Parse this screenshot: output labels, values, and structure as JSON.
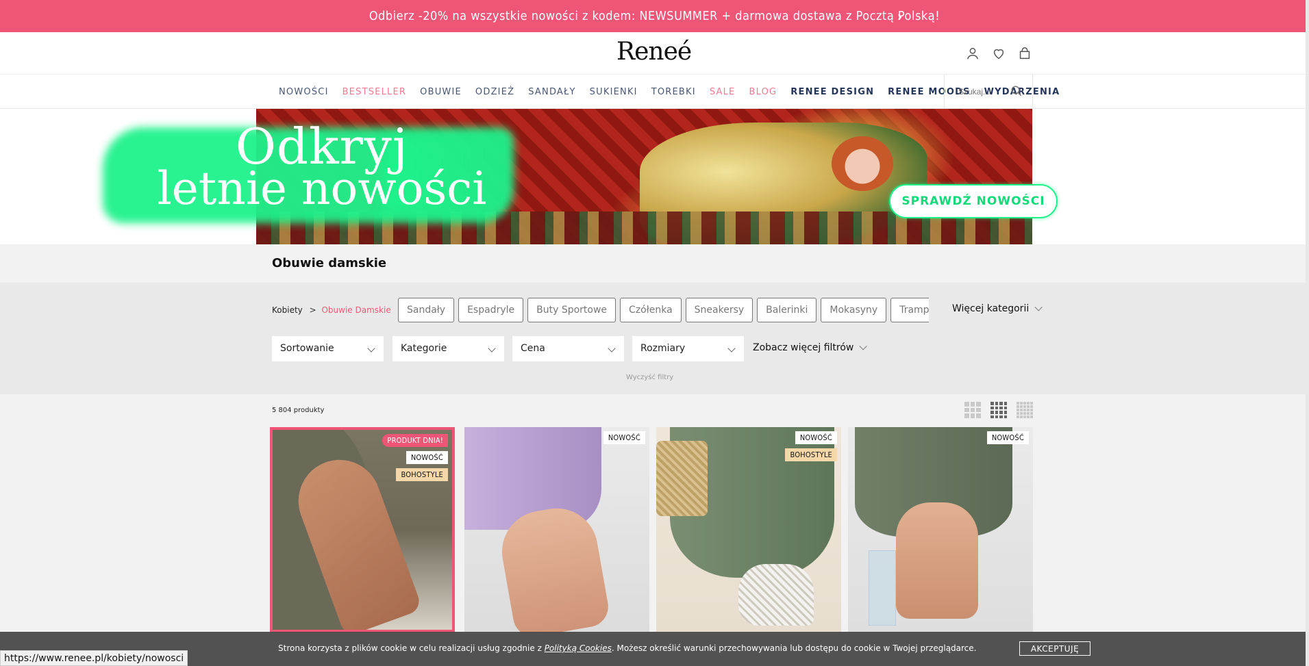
{
  "promo": {
    "text": "Odbierz -20% na wszystkie nowości z kodem: NEWSUMMER + darmowa dostawa z Pocztą Polską!",
    "chevron": "›"
  },
  "header": {
    "logo": "Reneé",
    "icons": [
      "user-icon",
      "heart-icon",
      "bag-icon"
    ]
  },
  "nav": {
    "items": [
      {
        "label": "NOWOŚCI",
        "style": "normal"
      },
      {
        "label": "BESTSELLER",
        "style": "pink"
      },
      {
        "label": "OBUWIE",
        "style": "normal"
      },
      {
        "label": "ODZIEŻ",
        "style": "normal"
      },
      {
        "label": "SANDAŁY",
        "style": "normal"
      },
      {
        "label": "SUKIENKI",
        "style": "normal"
      },
      {
        "label": "TOREBKI",
        "style": "normal"
      },
      {
        "label": "SALE",
        "style": "pink"
      },
      {
        "label": "BLOG",
        "style": "pink"
      },
      {
        "label": "RENEE DESIGN",
        "style": "bold"
      },
      {
        "label": "RENEE MOODS",
        "style": "bold"
      },
      {
        "label": "WYDARZENIA",
        "style": "bold"
      }
    ],
    "search_placeholder": "Szukaj..."
  },
  "banner": {
    "headline_line1": "Odkryj",
    "headline_line2": "letnie nowości",
    "cta": "SPRAWDŹ NOWOŚCI"
  },
  "page": {
    "title": "Obuwie damskie"
  },
  "breadcrumb": {
    "parent": "Kobiety",
    "separator": ">",
    "current": "Obuwie Damskie"
  },
  "categories": [
    "Sandały",
    "Espadryle",
    "Buty Sportowe",
    "Czółenka",
    "Sneakersy",
    "Balerinki",
    "Mokasyny",
    "Trampki"
  ],
  "more_categories": "Więcej kategorii",
  "filters": {
    "sort": "Sortowanie",
    "category": "Kategorie",
    "price": "Cena",
    "sizes": "Rozmiary",
    "more": "Zobacz więcej filtrów",
    "clear": "Wyczyść filtry"
  },
  "products": {
    "count": "5 804 produkty",
    "items": [
      {
        "badges": [
          {
            "text": "PRODUKT DNIA!",
            "type": "pink"
          },
          {
            "text": "NOWOŚĆ",
            "type": "white"
          },
          {
            "text": "BOHOSTYLE",
            "type": "boho"
          }
        ],
        "highlighted": true
      },
      {
        "badges": [
          {
            "text": "NOWOŚĆ",
            "type": "white"
          }
        ],
        "highlighted": false
      },
      {
        "badges": [
          {
            "text": "NOWOŚĆ",
            "type": "white"
          },
          {
            "text": "BOHOSTYLE",
            "type": "boho"
          }
        ],
        "highlighted": false
      },
      {
        "badges": [
          {
            "text": "NOWOŚĆ",
            "type": "white"
          }
        ],
        "highlighted": false
      }
    ]
  },
  "cookie": {
    "text_before": "Strona korzysta z plików cookie w celu realizacji usług zgodnie z ",
    "link": "Polityką Cookies",
    "text_after": ". Możesz określić warunki przechowywania lub dostępu do cookie w Twojej przeglądarce.",
    "accept": "AKCEPTUJĘ"
  },
  "status_url": "https://www.renee.pl/kobiety/nowosci",
  "colors": {
    "accent_pink": "#ef5577",
    "navy": "#263658",
    "banner_green": "#1ef28b"
  }
}
